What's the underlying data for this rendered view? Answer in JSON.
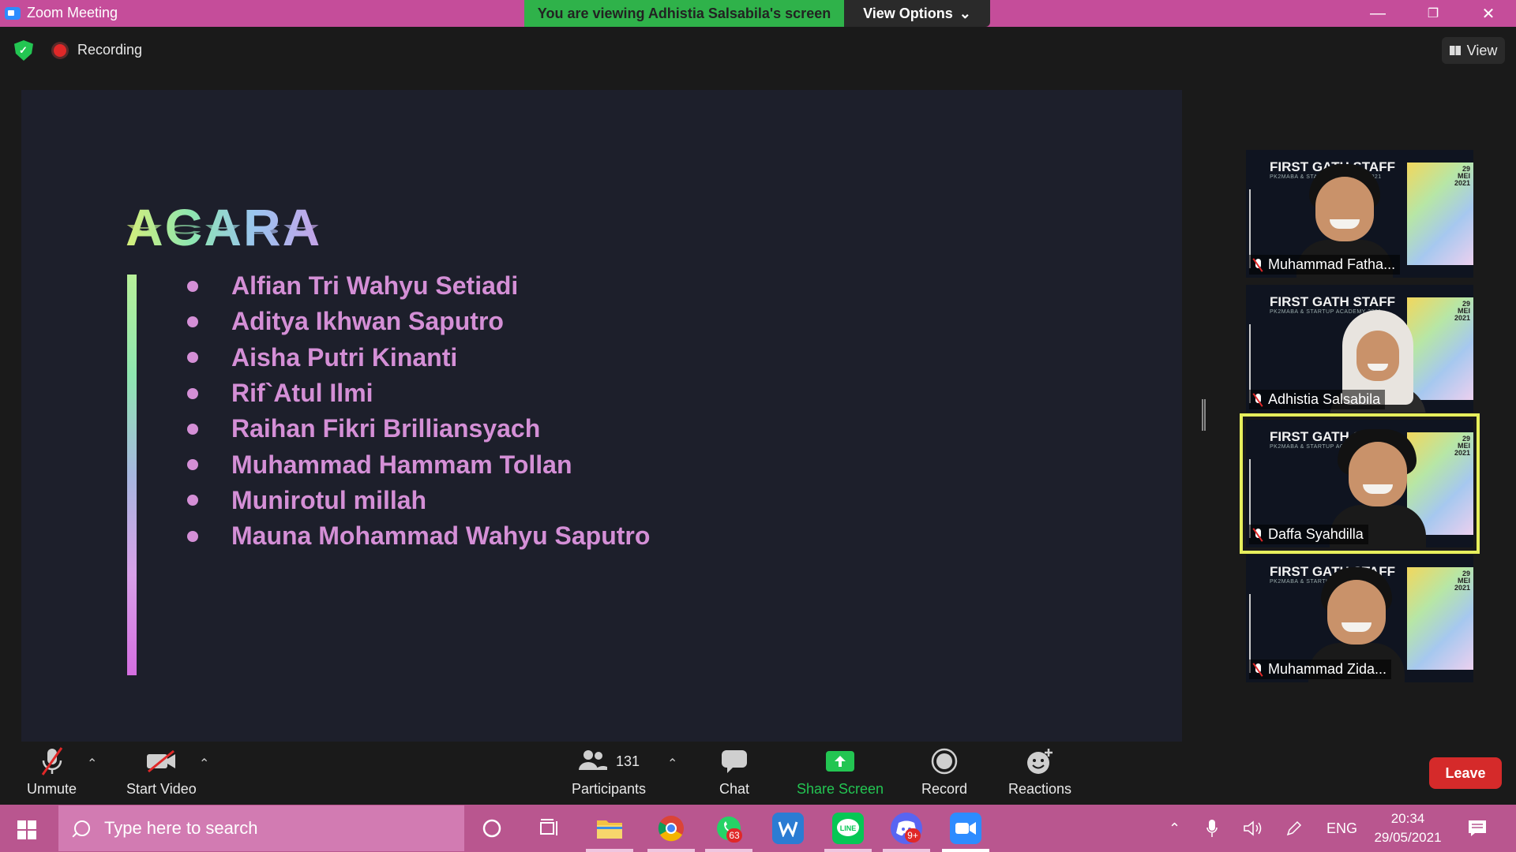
{
  "window": {
    "title": "Zoom Meeting",
    "viewing_banner": "You are viewing Adhistia Salsabila's screen",
    "view_options_label": "View Options"
  },
  "meeting": {
    "recording_label": "Recording",
    "view_label": "View"
  },
  "shared_screen": {
    "heading": "ACARA",
    "names": [
      "Alfian Tri Wahyu Setiadi",
      "Aditya Ikhwan Saputro",
      "Aisha Putri Kinanti",
      "Rif`Atul Ilmi",
      "Raihan Fikri Brilliansyach",
      "Muhammad Hammam Tollan",
      "Munirotul millah",
      "Mauna Mohammad Wahyu Saputro"
    ],
    "colors": {
      "background": "#1d1f2b",
      "names": "#d48fd6"
    }
  },
  "participants_panel": {
    "background_title": "FIRST GATH STAFF",
    "background_subtitle": "PK2MABA & STARTUP ACADEMY 2021",
    "background_date": [
      "29",
      "MEI",
      "2021"
    ],
    "tiles": [
      {
        "name": "Muhammad Fatha...",
        "active": false
      },
      {
        "name": "Adhistia Salsabila",
        "active": false
      },
      {
        "name": "Daffa Syahdilla",
        "active": true
      },
      {
        "name": "Muhammad Zida...",
        "active": false
      }
    ],
    "active_color": "#e7ef5c"
  },
  "toolbar": {
    "unmute_label": "Unmute",
    "start_video_label": "Start Video",
    "participants_label": "Participants",
    "participants_count": "131",
    "chat_label": "Chat",
    "share_screen_label": "Share Screen",
    "record_label": "Record",
    "reactions_label": "Reactions",
    "leave_label": "Leave"
  },
  "taskbar": {
    "search_placeholder": "Type here to search",
    "whatsapp_badge": "63",
    "discord_badge": "9+",
    "language": "ENG",
    "time": "20:34",
    "date": "29/05/2021"
  },
  "colors": {
    "titlebar": "#c54d9a",
    "viewing_banner": "#2fb24a",
    "taskbar": "#b9568f",
    "leave": "#d52a2a",
    "share_screen": "#23c552"
  }
}
